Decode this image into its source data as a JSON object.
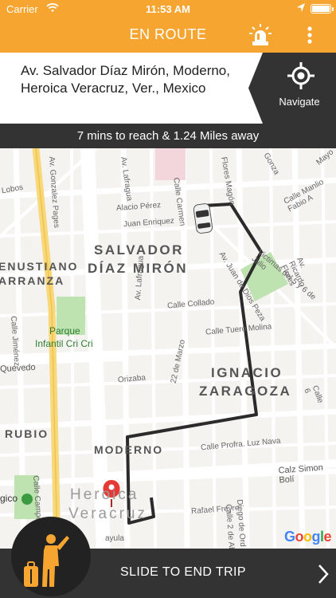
{
  "status_bar": {
    "carrier": "Carrier",
    "time": "11:53 AM"
  },
  "nav": {
    "title": "EN ROUTE",
    "alert_icon": "siren-icon",
    "menu_icon": "more-vertical-icon"
  },
  "address": {
    "text": "Av. Salvador Díaz Mirón, Moderno, Heroica Veracruz, Ver., Mexico",
    "navigate_label": "Navigate",
    "navigate_icon": "location-target-icon"
  },
  "eta": {
    "text": "7 mins to reach & 1.24 Miles away"
  },
  "map": {
    "areas": [
      "SALVADOR",
      "DÍAZ MIRÓN",
      "IGNACIO",
      "ZARAGOZA",
      "ENUSTIANO",
      "ARRANZA",
      "RUBIO",
      "MODERNO",
      "Heroica",
      "Veracruz"
    ],
    "streets": [
      "Alacio Pérez",
      "Juan Enriquez",
      "Av. Lafragua",
      "Calle Carmen",
      "Flores Magón",
      "Calle Collado",
      "Calle Tuero Molina",
      "Orizaba",
      "22 de Marzo",
      "Calle Profra. Luz Nava",
      "Calz Simon Bolí",
      "Rafael Freyre",
      "Diego de Ord",
      "Calle 2 de Ab",
      "Calle Manlio Fabio A",
      "Av. Ricardo Flores",
      "Victimas del 5 y 6 de Julio",
      "Av. Juan de Dios Peza",
      "Av. Gonzalez Pages",
      "Calle Jiménez",
      "Calle Campeche",
      "Quevedo",
      "Mayo",
      "Lobos",
      "Gonza",
      "Calle 6",
      "Av. Lafragua",
      "gico",
      "ayula"
    ],
    "pois": [
      "Parque",
      "Infantil Cri Cri"
    ],
    "attribution": "Google"
  },
  "bottom": {
    "slide_label": "SLIDE TO END TRIP",
    "driver_icon": "driver-luggage-icon",
    "chevron_icon": "chevron-right-icon"
  },
  "colors": {
    "brand": "#F7A531",
    "dark": "#333333",
    "route": "#2b2b2b",
    "pin": "#E53935"
  }
}
